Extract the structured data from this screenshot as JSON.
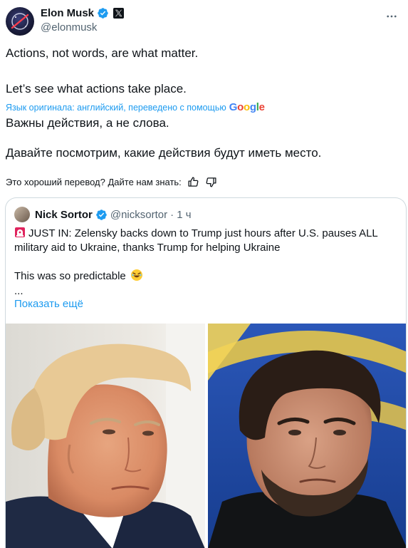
{
  "author": {
    "name": "Elon Musk",
    "handle": "@elonmusk",
    "verified_icon": "verified-badge-icon",
    "platform_icon": "x-logo-icon"
  },
  "tweet": {
    "line1": "Actions, not words, are what matter.",
    "line2": "Let’s see what actions take place.",
    "translation_note": "Язык оригинала: английский, переведено с помощью",
    "translation_provider": "Google",
    "translated_line1": "Важны действия, а не слова.",
    "translated_line2": "Давайте посмотрим, какие действия будут иметь место.",
    "feedback_prompt": "Это хороший перевод? Дайте нам знать:"
  },
  "quote": {
    "name": "Nick Sortor",
    "handle": "@nicksortor",
    "time": "· 1 ч",
    "line1": "JUST IN: Zelensky backs down to Trump just hours after U.S. pauses ALL",
    "line2": "military aid to Ukraine, thanks Trump for helping Ukraine",
    "line3": "This was so predictable",
    "ellipsis": "...",
    "show_more": "Показать ещё"
  },
  "colors": {
    "accent": "#1d9bf0",
    "text": "#0f1419",
    "muted": "#536471",
    "border": "#cfd9de"
  }
}
